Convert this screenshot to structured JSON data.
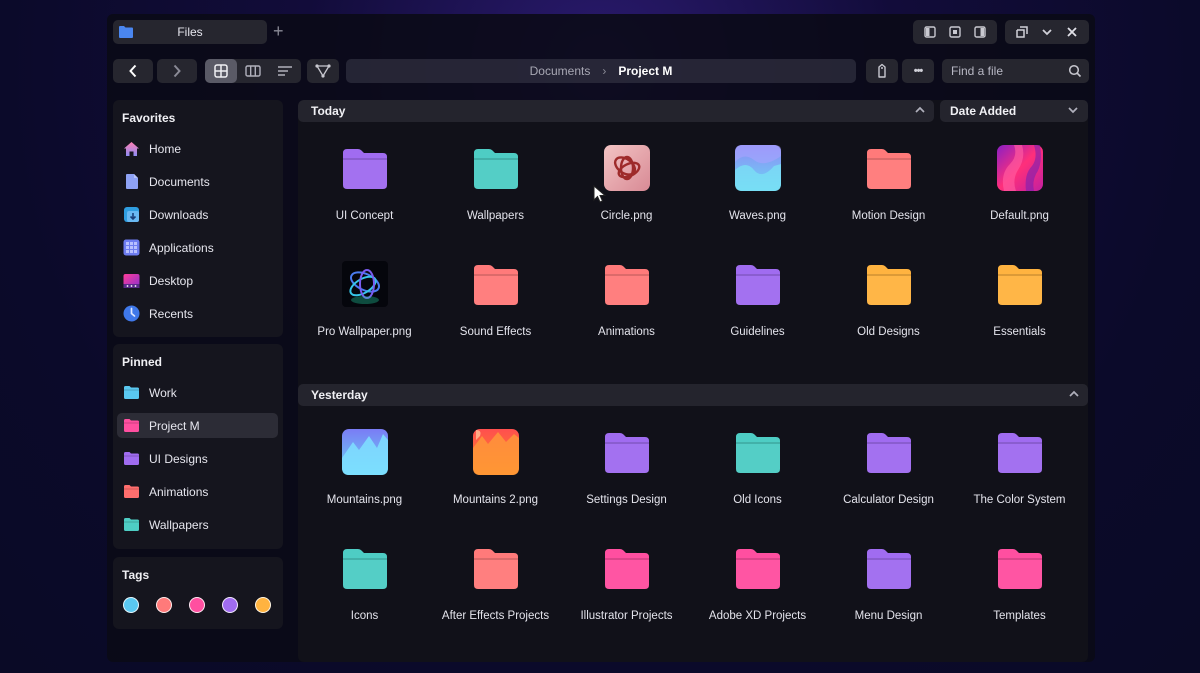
{
  "window": {
    "tab_title": "Files",
    "new_tab_label": "+"
  },
  "toolbar": {
    "back_icon": "chevron-left-icon",
    "forward_icon": "chevron-right-icon",
    "views": [
      "grid-view",
      "column-view",
      "list-view"
    ],
    "active_view": "grid-view",
    "breadcrumb": [
      "Documents",
      "Project M"
    ],
    "breadcrumb_separator": "›",
    "search_placeholder": "Find a file",
    "more_label": "•••"
  },
  "sidebar": {
    "favorites_title": "Favorites",
    "favorites": [
      {
        "label": "Home",
        "icon": "home-icon",
        "color": "#a78bfa"
      },
      {
        "label": "Documents",
        "icon": "document-icon",
        "color": "#8ea2f5"
      },
      {
        "label": "Downloads",
        "icon": "download-icon",
        "color": "#3aa0e6"
      },
      {
        "label": "Applications",
        "icon": "apps-grid-icon",
        "color": "#6d7cf0"
      },
      {
        "label": "Desktop",
        "icon": "desktop-icon",
        "color": "#e6399b"
      },
      {
        "label": "Recents",
        "icon": "clock-icon",
        "color": "#4a7ef0"
      }
    ],
    "pinned_title": "Pinned",
    "pinned": [
      {
        "label": "Work",
        "color": "#5ac8f0"
      },
      {
        "label": "Project M",
        "color": "#ff4fa0",
        "selected": true
      },
      {
        "label": "UI Designs",
        "color": "#a06cf0"
      },
      {
        "label": "Animations",
        "color": "#ff6e6e"
      },
      {
        "label": "Wallpapers",
        "color": "#4ecdc4"
      }
    ],
    "tags_title": "Tags",
    "tags": [
      {
        "name": "blue",
        "color": "#5ac8f0"
      },
      {
        "name": "coral",
        "color": "#ff7a7a"
      },
      {
        "name": "pink",
        "color": "#ff4fa0"
      },
      {
        "name": "purple",
        "color": "#a06cf0"
      },
      {
        "name": "orange",
        "color": "#ffb340"
      }
    ]
  },
  "sort": {
    "label": "Date Added"
  },
  "sections": [
    {
      "title": "Today",
      "items": [
        {
          "label": "UI Concept",
          "type": "folder",
          "color": "#a06cf0"
        },
        {
          "label": "Wallpapers",
          "type": "folder",
          "color": "#4ecdc4"
        },
        {
          "label": "Circle.png",
          "type": "image",
          "thumb": "circle"
        },
        {
          "label": "Waves.png",
          "type": "image",
          "thumb": "waves"
        },
        {
          "label": "Motion Design",
          "type": "folder",
          "color": "#ff7a7a"
        },
        {
          "label": "Default.png",
          "type": "image",
          "thumb": "default"
        },
        {
          "label": "Pro Wallpaper.png",
          "type": "image",
          "thumb": "pro"
        },
        {
          "label": "Sound Effects",
          "type": "folder",
          "color": "#ff7a7a"
        },
        {
          "label": "Animations",
          "type": "folder",
          "color": "#ff7a7a"
        },
        {
          "label": "Guidelines",
          "type": "folder",
          "color": "#a06cf0"
        },
        {
          "label": "Old Designs",
          "type": "folder",
          "color": "#ffb340"
        },
        {
          "label": "Essentials",
          "type": "folder",
          "color": "#ffb340"
        }
      ]
    },
    {
      "title": "Yesterday",
      "items": [
        {
          "label": "Mountains.png",
          "type": "image",
          "thumb": "mountains"
        },
        {
          "label": "Mountains 2.png",
          "type": "image",
          "thumb": "mountains2"
        },
        {
          "label": "Settings Design",
          "type": "folder",
          "color": "#a06cf0"
        },
        {
          "label": "Old Icons",
          "type": "folder",
          "color": "#4ecdc4"
        },
        {
          "label": "Calculator Design",
          "type": "folder",
          "color": "#a06cf0"
        },
        {
          "label": "The Color System",
          "type": "folder",
          "color": "#a06cf0"
        },
        {
          "label": "Icons",
          "type": "folder",
          "color": "#4ecdc4"
        },
        {
          "label": "After Effects Projects",
          "type": "folder",
          "color": "#ff7a7a"
        },
        {
          "label": "Illustrator Projects",
          "type": "folder",
          "color": "#ff4fa0"
        },
        {
          "label": "Adobe XD Projects",
          "type": "folder",
          "color": "#ff4fa0"
        },
        {
          "label": "Menu Design",
          "type": "folder",
          "color": "#a06cf0"
        },
        {
          "label": "Templates",
          "type": "folder",
          "color": "#ff4fa0"
        }
      ]
    }
  ]
}
